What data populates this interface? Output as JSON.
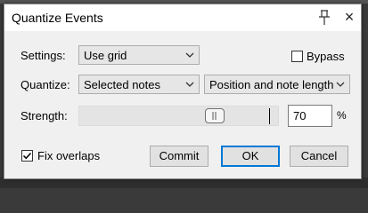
{
  "dialog": {
    "title": "Quantize Events",
    "pin_icon": "pin-icon",
    "close_label": "×"
  },
  "settings": {
    "label": "Settings:",
    "value": "Use grid"
  },
  "bypass": {
    "label": "Bypass",
    "checked": false
  },
  "quantize": {
    "label": "Quantize:",
    "scope_value": "Selected notes",
    "mode_value": "Position and note length"
  },
  "strength": {
    "label": "Strength:",
    "value": "70",
    "unit": "%",
    "level_percent": 70
  },
  "fix_overlaps": {
    "label": "Fix overlaps",
    "checked": true
  },
  "buttons": {
    "commit": "Commit",
    "ok": "OK",
    "cancel": "Cancel"
  },
  "colors": {
    "dialog_bg": "#f0f0f0",
    "focus_border": "#0078d7",
    "backdrop": "#3a3a3a"
  }
}
